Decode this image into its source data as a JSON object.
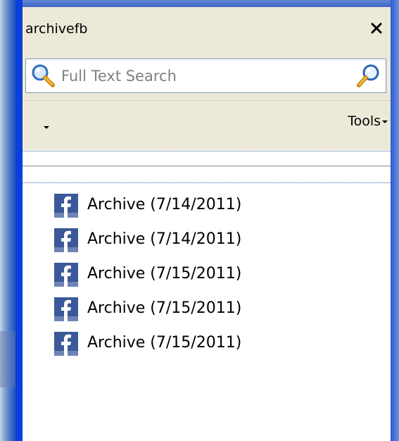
{
  "pane": {
    "title": "archivefb",
    "close_icon": "close-icon"
  },
  "search": {
    "placeholder": "Full Text Search",
    "value": "",
    "left_icon": "magnifier-icon",
    "right_icon": "search-go-icon"
  },
  "toolbar": {
    "dropdown_icon": "chevron-down-icon",
    "tools_label": "Tools"
  },
  "filter": {
    "value": ""
  },
  "items": [
    {
      "label": "Archive (7/14/2011)",
      "icon": "facebook-icon"
    },
    {
      "label": "Archive (7/14/2011)",
      "icon": "facebook-icon"
    },
    {
      "label": "Archive (7/15/2011)",
      "icon": "facebook-icon"
    },
    {
      "label": "Archive (7/15/2011)",
      "icon": "facebook-icon"
    },
    {
      "label": "Archive (7/15/2011)",
      "icon": "facebook-icon"
    }
  ],
  "colors": {
    "window_border": "#0a3fd9",
    "pane_header": "#ece9d8",
    "facebook_blue": "#3b5998"
  }
}
